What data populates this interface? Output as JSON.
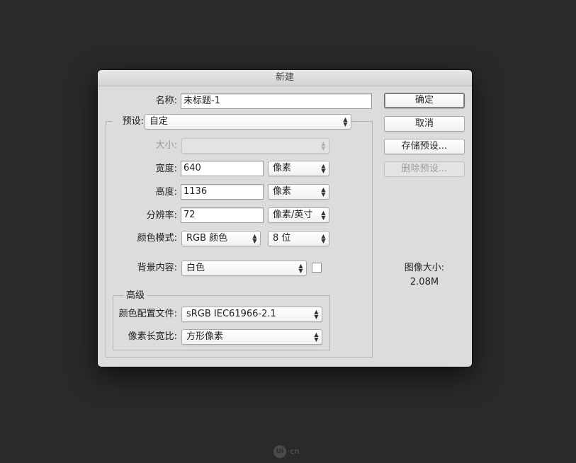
{
  "dialog": {
    "title": "新建"
  },
  "fields": {
    "name_label": "名称:",
    "name_value": "未标题-1",
    "preset_label": "预设:",
    "preset_value": "自定",
    "size_label": "大小:",
    "size_value": "",
    "width_label": "宽度:",
    "width_value": "640",
    "width_unit": "像素",
    "height_label": "高度:",
    "height_value": "1136",
    "height_unit": "像素",
    "resolution_label": "分辨率:",
    "resolution_value": "72",
    "resolution_unit": "像素/英寸",
    "color_mode_label": "颜色模式:",
    "color_mode_value": "RGB 颜色",
    "bit_depth_value": "8 位",
    "background_label": "背景内容:",
    "background_value": "白色",
    "background_swatch_color": "#ffffff"
  },
  "advanced": {
    "legend": "高级",
    "profile_label": "颜色配置文件:",
    "profile_value": "sRGB IEC61966-2.1",
    "pixel_aspect_label": "像素长宽比:",
    "pixel_aspect_value": "方形像素"
  },
  "buttons": {
    "ok": "确定",
    "cancel": "取消",
    "save_preset": "存储预设...",
    "delete_preset": "删除预设..."
  },
  "image_size": {
    "label": "图像大小:",
    "value": "2.08M"
  },
  "watermark": {
    "logo": "Ui",
    "text": "·cn"
  }
}
